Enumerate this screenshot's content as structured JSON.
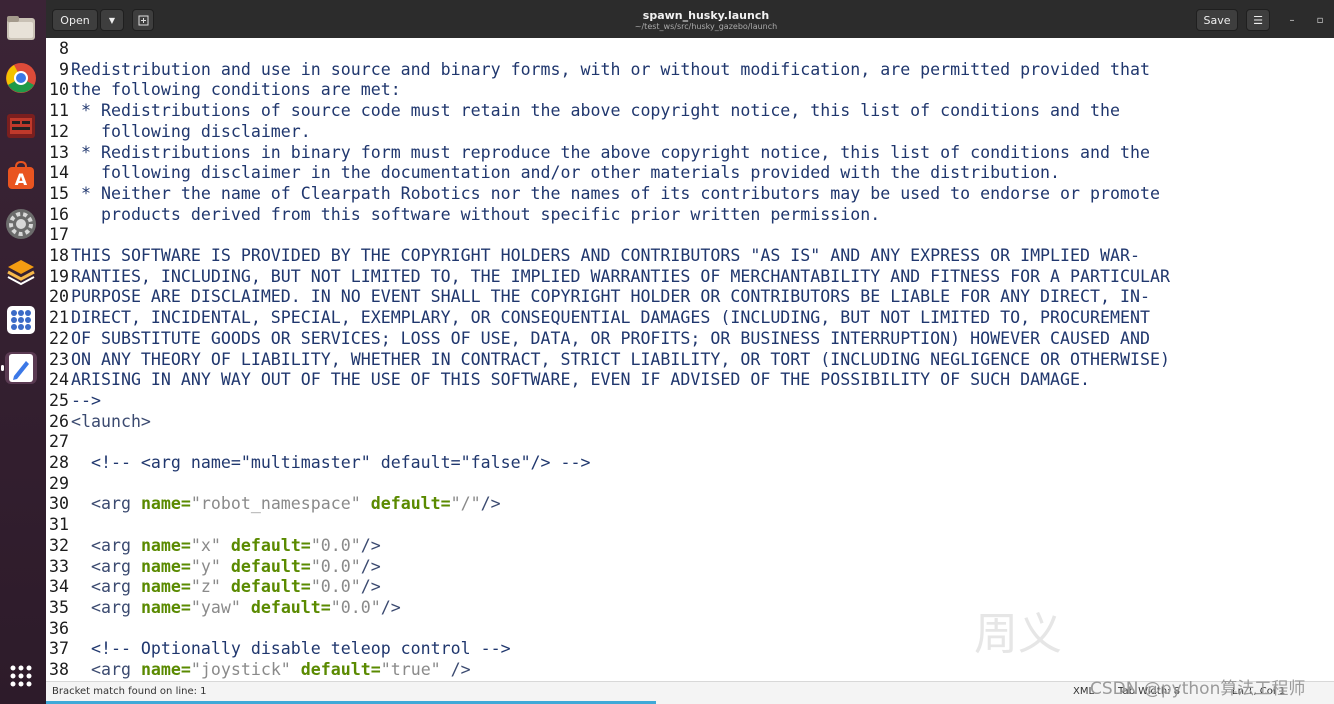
{
  "window": {
    "title": "spawn_husky.launch",
    "subtitle": "~/test_ws/src/husky_gazebo/launch",
    "open_label": "Open",
    "save_label": "Save"
  },
  "dock": {
    "items": [
      "files-icon",
      "chrome-icon",
      "terminal-icon",
      "app-store-icon",
      "settings-icon",
      "layers-icon",
      "apps-icon",
      "text-editor-icon"
    ],
    "show_apps": "apps-grid-icon"
  },
  "editor": {
    "lines": [
      {
        "n": "8",
        "segs": [
          {
            "t": "",
            "c": "c-comment"
          }
        ]
      },
      {
        "n": "9",
        "segs": [
          {
            "t": "Redistribution and use in source and binary forms, with or without modification, are permitted provided that",
            "c": "c-comment"
          }
        ]
      },
      {
        "n": "10",
        "segs": [
          {
            "t": "the following conditions are met:",
            "c": "c-comment"
          }
        ]
      },
      {
        "n": "11",
        "segs": [
          {
            "t": " * Redistributions of source code must retain the above copyright notice, this list of conditions and the",
            "c": "c-comment"
          }
        ]
      },
      {
        "n": "12",
        "segs": [
          {
            "t": "   following disclaimer.",
            "c": "c-comment"
          }
        ]
      },
      {
        "n": "13",
        "segs": [
          {
            "t": " * Redistributions in binary form must reproduce the above copyright notice, this list of conditions and the",
            "c": "c-comment"
          }
        ]
      },
      {
        "n": "14",
        "segs": [
          {
            "t": "   following disclaimer in the documentation and/or other materials provided with the distribution.",
            "c": "c-comment"
          }
        ]
      },
      {
        "n": "15",
        "segs": [
          {
            "t": " * Neither the name of Clearpath Robotics nor the names of its contributors may be used to endorse or promote",
            "c": "c-comment"
          }
        ]
      },
      {
        "n": "16",
        "segs": [
          {
            "t": "   products derived from this software without specific prior written permission.",
            "c": "c-comment"
          }
        ]
      },
      {
        "n": "17",
        "segs": [
          {
            "t": "",
            "c": "c-comment"
          }
        ]
      },
      {
        "n": "18",
        "segs": [
          {
            "t": "THIS SOFTWARE IS PROVIDED BY THE COPYRIGHT HOLDERS AND CONTRIBUTORS \"AS IS\" AND ANY EXPRESS OR IMPLIED WAR-",
            "c": "c-comment"
          }
        ]
      },
      {
        "n": "19",
        "segs": [
          {
            "t": "RANTIES, INCLUDING, BUT NOT LIMITED TO, THE IMPLIED WARRANTIES OF MERCHANTABILITY AND FITNESS FOR A PARTICULAR",
            "c": "c-comment"
          }
        ]
      },
      {
        "n": "20",
        "segs": [
          {
            "t": "PURPOSE ARE DISCLAIMED. IN NO EVENT SHALL THE COPYRIGHT HOLDER OR CONTRIBUTORS BE LIABLE FOR ANY DIRECT, IN-",
            "c": "c-comment"
          }
        ]
      },
      {
        "n": "21",
        "segs": [
          {
            "t": "DIRECT, INCIDENTAL, SPECIAL, EXEMPLARY, OR CONSEQUENTIAL DAMAGES (INCLUDING, BUT NOT LIMITED TO, PROCUREMENT",
            "c": "c-comment"
          }
        ]
      },
      {
        "n": "22",
        "segs": [
          {
            "t": "OF SUBSTITUTE GOODS OR SERVICES; LOSS OF USE, DATA, OR PROFITS; OR BUSINESS INTERRUPTION) HOWEVER CAUSED AND",
            "c": "c-comment"
          }
        ]
      },
      {
        "n": "23",
        "segs": [
          {
            "t": "ON ANY THEORY OF LIABILITY, WHETHER IN CONTRACT, STRICT LIABILITY, OR TORT (INCLUDING NEGLIGENCE OR OTHERWISE)",
            "c": "c-comment"
          }
        ]
      },
      {
        "n": "24",
        "segs": [
          {
            "t": "ARISING IN ANY WAY OUT OF THE USE OF THIS SOFTWARE, EVEN IF ADVISED OF THE POSSIBILITY OF SUCH DAMAGE.",
            "c": "c-comment"
          }
        ]
      },
      {
        "n": "25",
        "segs": [
          {
            "t": "-->",
            "c": "c-comment"
          }
        ]
      },
      {
        "n": "26",
        "segs": [
          {
            "t": "<launch>",
            "c": "c-tag"
          }
        ]
      },
      {
        "n": "27",
        "segs": [
          {
            "t": "",
            "c": "c-plain"
          }
        ]
      },
      {
        "n": "28",
        "segs": [
          {
            "t": "  <!-- <arg name=\"multimaster\" default=\"false\"/> -->",
            "c": "c-comment"
          }
        ]
      },
      {
        "n": "29",
        "segs": [
          {
            "t": "",
            "c": "c-plain"
          }
        ]
      },
      {
        "n": "30",
        "segs": [
          {
            "t": "  <arg ",
            "c": "c-tag"
          },
          {
            "t": "name=",
            "c": "c-attr"
          },
          {
            "t": "\"robot_namespace\"",
            "c": "c-val"
          },
          {
            "t": " ",
            "c": "c-tag"
          },
          {
            "t": "default=",
            "c": "c-attr"
          },
          {
            "t": "\"/\"",
            "c": "c-val"
          },
          {
            "t": "/>",
            "c": "c-tag"
          }
        ]
      },
      {
        "n": "31",
        "segs": [
          {
            "t": "",
            "c": "c-plain"
          }
        ]
      },
      {
        "n": "32",
        "segs": [
          {
            "t": "  <arg ",
            "c": "c-tag"
          },
          {
            "t": "name=",
            "c": "c-attr"
          },
          {
            "t": "\"x\"",
            "c": "c-val"
          },
          {
            "t": " ",
            "c": "c-tag"
          },
          {
            "t": "default=",
            "c": "c-attr"
          },
          {
            "t": "\"0.0\"",
            "c": "c-val"
          },
          {
            "t": "/>",
            "c": "c-tag"
          }
        ]
      },
      {
        "n": "33",
        "segs": [
          {
            "t": "  <arg ",
            "c": "c-tag"
          },
          {
            "t": "name=",
            "c": "c-attr"
          },
          {
            "t": "\"y\"",
            "c": "c-val"
          },
          {
            "t": " ",
            "c": "c-tag"
          },
          {
            "t": "default=",
            "c": "c-attr"
          },
          {
            "t": "\"0.0\"",
            "c": "c-val"
          },
          {
            "t": "/>",
            "c": "c-tag"
          }
        ]
      },
      {
        "n": "34",
        "segs": [
          {
            "t": "  <arg ",
            "c": "c-tag"
          },
          {
            "t": "name=",
            "c": "c-attr"
          },
          {
            "t": "\"z\"",
            "c": "c-val"
          },
          {
            "t": " ",
            "c": "c-tag"
          },
          {
            "t": "default=",
            "c": "c-attr"
          },
          {
            "t": "\"0.0\"",
            "c": "c-val"
          },
          {
            "t": "/>",
            "c": "c-tag"
          }
        ]
      },
      {
        "n": "35",
        "segs": [
          {
            "t": "  <arg ",
            "c": "c-tag"
          },
          {
            "t": "name=",
            "c": "c-attr"
          },
          {
            "t": "\"yaw\"",
            "c": "c-val"
          },
          {
            "t": " ",
            "c": "c-tag"
          },
          {
            "t": "default=",
            "c": "c-attr"
          },
          {
            "t": "\"0.0\"",
            "c": "c-val"
          },
          {
            "t": "/>",
            "c": "c-tag"
          }
        ]
      },
      {
        "n": "36",
        "segs": [
          {
            "t": "",
            "c": "c-plain"
          }
        ]
      },
      {
        "n": "37",
        "segs": [
          {
            "t": "  <!-- Optionally disable teleop control -->",
            "c": "c-comment"
          }
        ]
      },
      {
        "n": "38",
        "segs": [
          {
            "t": "  <arg ",
            "c": "c-tag"
          },
          {
            "t": "name=",
            "c": "c-attr"
          },
          {
            "t": "\"joystick\"",
            "c": "c-val"
          },
          {
            "t": " ",
            "c": "c-tag"
          },
          {
            "t": "default=",
            "c": "c-attr"
          },
          {
            "t": "\"true\"",
            "c": "c-val"
          },
          {
            "t": " />",
            "c": "c-tag"
          }
        ]
      }
    ]
  },
  "watermark": "周义",
  "status": {
    "message": "Bracket match found on line: 1",
    "language": "XML",
    "tab_width": "Tab Width: 8",
    "position": "Ln 1, Col 1"
  },
  "overlay": {
    "csdn": "CSDN @python算法工程师"
  },
  "colors": {
    "dock_bg": "#3a1e32",
    "headerbar_bg": "#2c2c2c",
    "comment": "#20376e",
    "attr": "#5a8a00",
    "value": "#8a8a8a"
  }
}
